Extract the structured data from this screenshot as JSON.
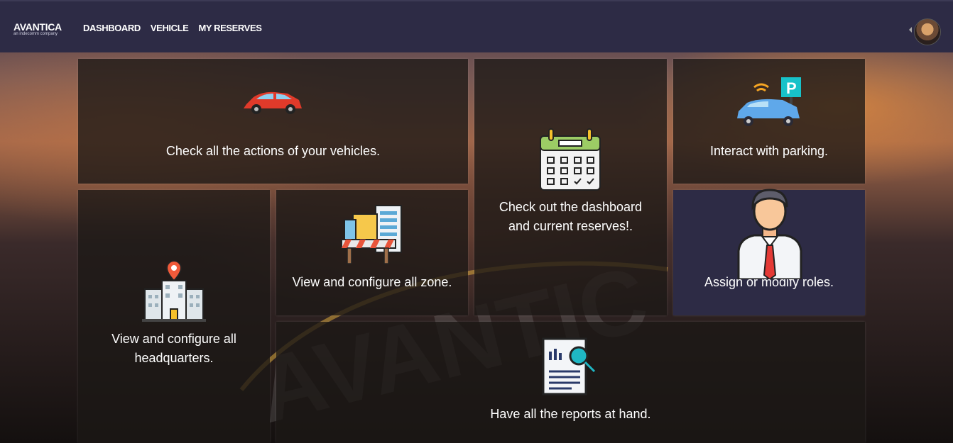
{
  "header": {
    "brand": "AVANTICA",
    "brand_sub": "an indecomm company",
    "nav": [
      "DASHBOARD",
      "VEHICLE",
      "MY RESERVES"
    ]
  },
  "cards": {
    "vehicles": {
      "label": "Check all the actions of your vehicles.",
      "icon": "car-icon"
    },
    "dashboard": {
      "label": "Check out the dashboard and current reserves!.",
      "icon": "calendar-icon"
    },
    "parking": {
      "label": "Interact with parking.",
      "icon": "parking-icon"
    },
    "headquarters": {
      "label": "View and configure all headquarters.",
      "icon": "building-pin-icon"
    },
    "zone": {
      "label": "View and configure all zone.",
      "icon": "zone-barrier-icon"
    },
    "roles": {
      "label": "Assign or modify roles.",
      "icon": "businessman-icon"
    },
    "reports": {
      "label": "Have all the reports at hand.",
      "icon": "report-search-icon"
    }
  },
  "colors": {
    "topbar": "#2d2b45",
    "card": "#1c1816",
    "active_card": "#2d2b45"
  }
}
